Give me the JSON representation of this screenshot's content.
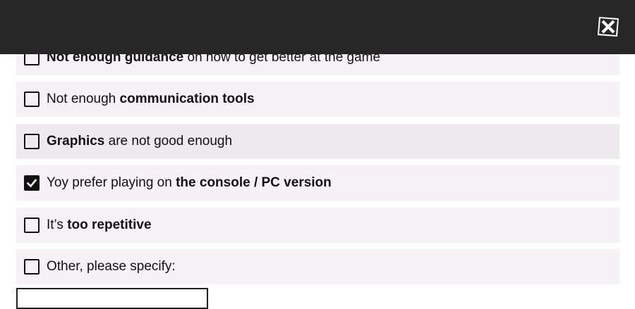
{
  "options": [
    {
      "parts": [
        {
          "text": "Not enough guidance",
          "bold": true
        },
        {
          "text": " on how to get better at the game",
          "bold": false
        }
      ],
      "checked": false
    },
    {
      "parts": [
        {
          "text": "Not enough ",
          "bold": false
        },
        {
          "text": "communication tools",
          "bold": true
        }
      ],
      "checked": false
    },
    {
      "parts": [
        {
          "text": "Graphics",
          "bold": true
        },
        {
          "text": " are not good enough",
          "bold": false
        }
      ],
      "checked": false
    },
    {
      "parts": [
        {
          "text": "Yoy prefer playing on ",
          "bold": false
        },
        {
          "text": "the console / PC version",
          "bold": true
        }
      ],
      "checked": true
    },
    {
      "parts": [
        {
          "text": "It’s ",
          "bold": false
        },
        {
          "text": "too repetitive",
          "bold": true
        }
      ],
      "checked": false
    },
    {
      "parts": [
        {
          "text": "Other, please specify:",
          "bold": false
        }
      ],
      "checked": false
    }
  ],
  "other_input": {
    "value": "",
    "placeholder": ""
  },
  "header": {
    "close_icon": "close-icon"
  },
  "colors": {
    "header_bg": "#262626",
    "option_bg": "#f6f1f5",
    "option_hover_bg": "#eeeaee",
    "checkbox": "#111111",
    "text": "#111111"
  }
}
